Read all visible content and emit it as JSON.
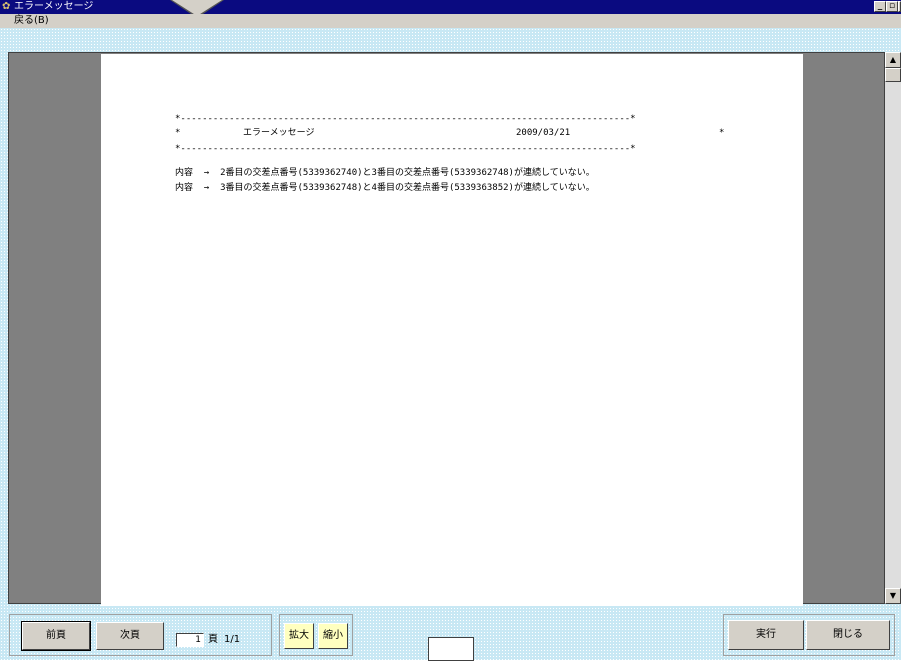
{
  "window": {
    "title": "エラーメッセージ"
  },
  "menu": {
    "back": "戻る(B)"
  },
  "report": {
    "border_line": "*-----------------------------------------------------------------------------------*",
    "header_star_left": "*",
    "header_title": "エラーメッセージ",
    "header_date": "2009/03/21",
    "header_star_right": "*",
    "lines": [
      "内容  →  2番目の交差点番号(5339362740)と3番目の交差点番号(5339362748)が連続していない。",
      "内容  →  3番目の交差点番号(5339362748)と4番目の交差点番号(5339363852)が連続していない。"
    ]
  },
  "nav": {
    "prev_label": "前頁",
    "next_label": "次頁",
    "page_value": "1",
    "page_unit": "頁",
    "page_count": "1/1",
    "zoom_in_label": "拡大",
    "zoom_out_label": "縮小"
  },
  "actions": {
    "run_label": "実行",
    "close_label": "閉じる"
  }
}
